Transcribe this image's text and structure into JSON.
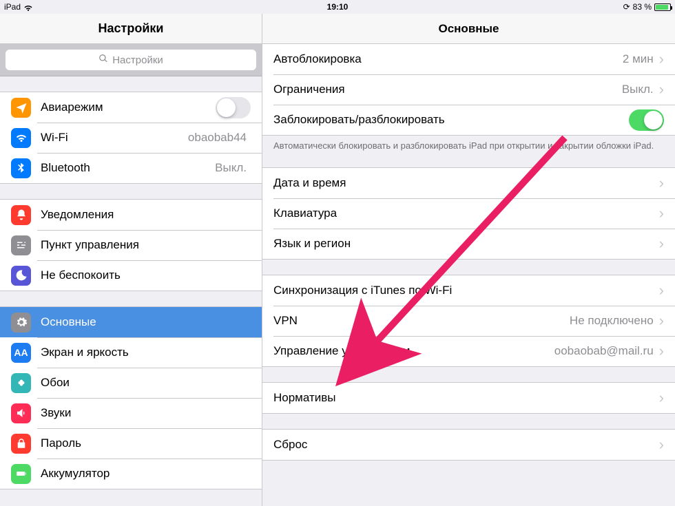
{
  "statusbar": {
    "device": "iPad",
    "time": "19:10",
    "battery_pct": "83 %"
  },
  "sidebar": {
    "title": "Настройки",
    "search_placeholder": "Настройки",
    "groups": [
      [
        {
          "key": "airplane",
          "label": "Авиарежим",
          "toggle": false,
          "icon": "plane",
          "bg": "bg-orange"
        },
        {
          "key": "wifi",
          "label": "Wi-Fi",
          "value": "obaobab44",
          "icon": "wifi",
          "bg": "bg-blue"
        },
        {
          "key": "bluetooth",
          "label": "Bluetooth",
          "value": "Выкл.",
          "icon": "bt",
          "bg": "bg-blue"
        }
      ],
      [
        {
          "key": "notifications",
          "label": "Уведомления",
          "icon": "bell",
          "bg": "bg-red"
        },
        {
          "key": "controlcenter",
          "label": "Пункт управления",
          "icon": "sliders",
          "bg": "bg-gray"
        },
        {
          "key": "dnd",
          "label": "Не беспокоить",
          "icon": "moon",
          "bg": "bg-indigo"
        }
      ],
      [
        {
          "key": "general",
          "label": "Основные",
          "icon": "gear",
          "bg": "bg-gray",
          "selected": true
        },
        {
          "key": "display",
          "label": "Экран и яркость",
          "icon": "aa",
          "bg": "bg-blue2"
        },
        {
          "key": "wallpaper",
          "label": "Обои",
          "icon": "flower",
          "bg": "bg-teal"
        },
        {
          "key": "sounds",
          "label": "Звуки",
          "icon": "speaker",
          "bg": "bg-redspk"
        },
        {
          "key": "passcode",
          "label": "Пароль",
          "icon": "lock",
          "bg": "bg-red"
        },
        {
          "key": "battery",
          "label": "Аккумулятор",
          "icon": "battery",
          "bg": "bg-green"
        }
      ]
    ]
  },
  "detail": {
    "title": "Основные",
    "sections": [
      {
        "rows": [
          {
            "key": "autolock",
            "label": "Автоблокировка",
            "value": "2 мин",
            "chev": true
          },
          {
            "key": "restrictions",
            "label": "Ограничения",
            "value": "Выкл.",
            "chev": true
          },
          {
            "key": "lockunlock",
            "label": "Заблокировать/разблокировать",
            "toggle": true
          }
        ],
        "footer": "Автоматически блокировать и разблокировать iPad при открытии и закрытии обложки iPad."
      },
      {
        "rows": [
          {
            "key": "datetime",
            "label": "Дата и время",
            "chev": true
          },
          {
            "key": "keyboard",
            "label": "Клавиатура",
            "chev": true
          },
          {
            "key": "language",
            "label": "Язык и регион",
            "chev": true
          }
        ]
      },
      {
        "rows": [
          {
            "key": "itunessync",
            "label": "Синхронизация с iTunes по Wi-Fi",
            "chev": true
          },
          {
            "key": "vpn",
            "label": "VPN",
            "value": "Не подключено",
            "chev": true
          },
          {
            "key": "devicemgmt",
            "label": "Управление устройством",
            "value": "oobaobab@mail.ru",
            "chev": true
          }
        ]
      },
      {
        "rows": [
          {
            "key": "regulatory",
            "label": "Нормативы",
            "chev": true
          }
        ]
      },
      {
        "rows": [
          {
            "key": "reset",
            "label": "Сброс",
            "chev": true
          }
        ]
      }
    ]
  },
  "annotation": {
    "arrow_color": "#ea1e63"
  }
}
